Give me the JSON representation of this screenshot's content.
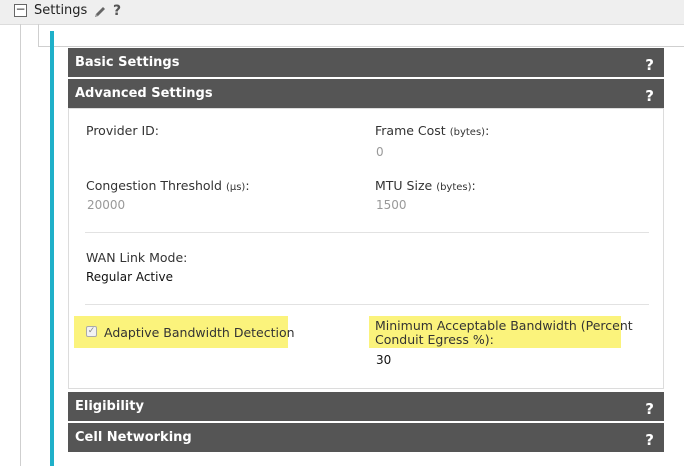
{
  "header": {
    "collapse_symbol": "−",
    "title": "Settings",
    "help": "?"
  },
  "panels": {
    "basic": {
      "title": "Basic Settings",
      "help": "?"
    },
    "advanced": {
      "title": "Advanced Settings",
      "help": "?"
    },
    "eligibility": {
      "title": "Eligibility",
      "help": "?"
    },
    "cell": {
      "title": "Cell Networking",
      "help": "?"
    }
  },
  "advanced": {
    "provider_id": {
      "label": "Provider ID:"
    },
    "frame_cost": {
      "label": "Frame Cost",
      "unit": "(bytes)",
      "suffix": ":",
      "value": "0"
    },
    "congestion_threshold": {
      "label": "Congestion Threshold",
      "unit": "(μs)",
      "suffix": ":",
      "value": "20000"
    },
    "mtu_size": {
      "label": "MTU Size",
      "unit": "(bytes)",
      "suffix": ":",
      "value": "1500"
    },
    "wan_link_mode": {
      "label": "WAN Link Mode:",
      "value": "Regular Active"
    },
    "adaptive_bandwidth": {
      "label": "Adaptive Bandwidth Detection",
      "checked": true,
      "check_symbol": "✓"
    },
    "min_bandwidth": {
      "label_line1": "Minimum Acceptable Bandwidth (Percent",
      "label_line2": "Conduit Egress %):",
      "value": "30"
    }
  },
  "colors": {
    "accent": "#1fb0c9",
    "header_bg": "#555555",
    "highlight": "#fbf37c"
  },
  "icons": {
    "edit": "pencil-icon",
    "help": "question-icon",
    "collapse": "minus-box-icon"
  }
}
